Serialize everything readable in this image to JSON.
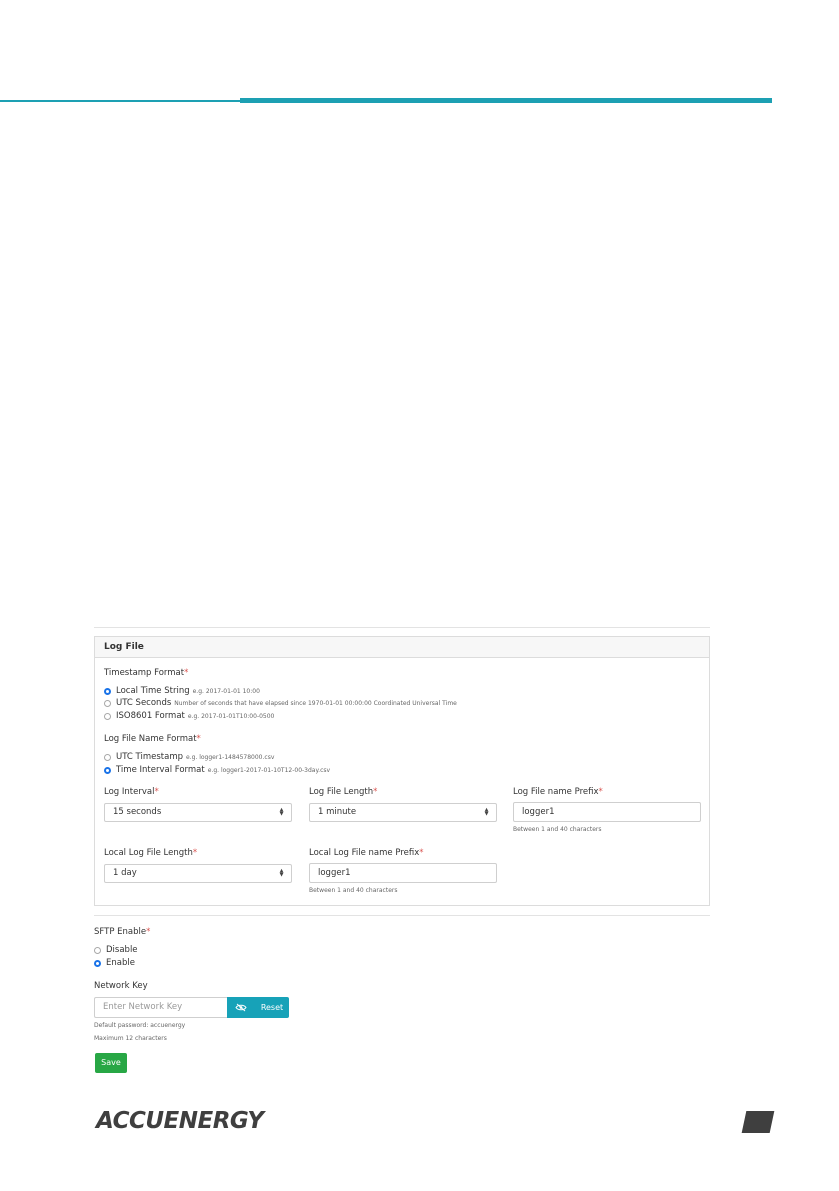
{
  "colors": {
    "accent": "#1da0b3",
    "required": "#d9534f",
    "radio_selected": "#1a73e8",
    "save": "#28a745",
    "reset": "#17a2b8"
  },
  "log_file": {
    "title": "Log File",
    "timestamp_format": {
      "label": "Timestamp Format",
      "options": [
        {
          "label": "Local Time String",
          "hint": "e.g. 2017-01-01 10:00",
          "selected": true
        },
        {
          "label": "UTC Seconds",
          "hint": "Number of seconds that have elapsed since 1970-01-01 00:00:00 Coordinated Universal Time",
          "selected": false
        },
        {
          "label": "ISO8601 Format",
          "hint": "e.g. 2017-01-01T10:00-0500",
          "selected": false
        }
      ]
    },
    "file_name_format": {
      "label": "Log File Name Format",
      "options": [
        {
          "label": "UTC Timestamp",
          "hint": "e.g. logger1-1484578000.csv",
          "selected": false
        },
        {
          "label": "Time Interval Format",
          "hint": "e.g. logger1-2017-01-10T12-00-3day.csv",
          "selected": true
        }
      ]
    },
    "log_interval": {
      "label": "Log Interval",
      "value": "15 seconds"
    },
    "log_file_length": {
      "label": "Log File Length",
      "value": "1 minute"
    },
    "log_file_prefix": {
      "label": "Log File name Prefix",
      "value": "logger1",
      "help": "Between 1 and 40 characters"
    },
    "local_log_file_length": {
      "label": "Local Log File Length",
      "value": "1 day"
    },
    "local_log_file_prefix": {
      "label": "Local Log File name Prefix",
      "value": "logger1",
      "help": "Between 1 and 40 characters"
    }
  },
  "sftp": {
    "label": "SFTP Enable",
    "options": [
      {
        "label": "Disable",
        "selected": false
      },
      {
        "label": "Enable",
        "selected": true
      }
    ]
  },
  "network_key": {
    "label": "Network Key",
    "placeholder": "Enter Network Key",
    "reset_label": "Reset",
    "help1": "Default password: accuenergy",
    "help2": "Maximum 12 characters"
  },
  "save_label": "Save",
  "brand": {
    "logo_text": "ACCUENERGY",
    "icon": "eye-slash-icon"
  }
}
